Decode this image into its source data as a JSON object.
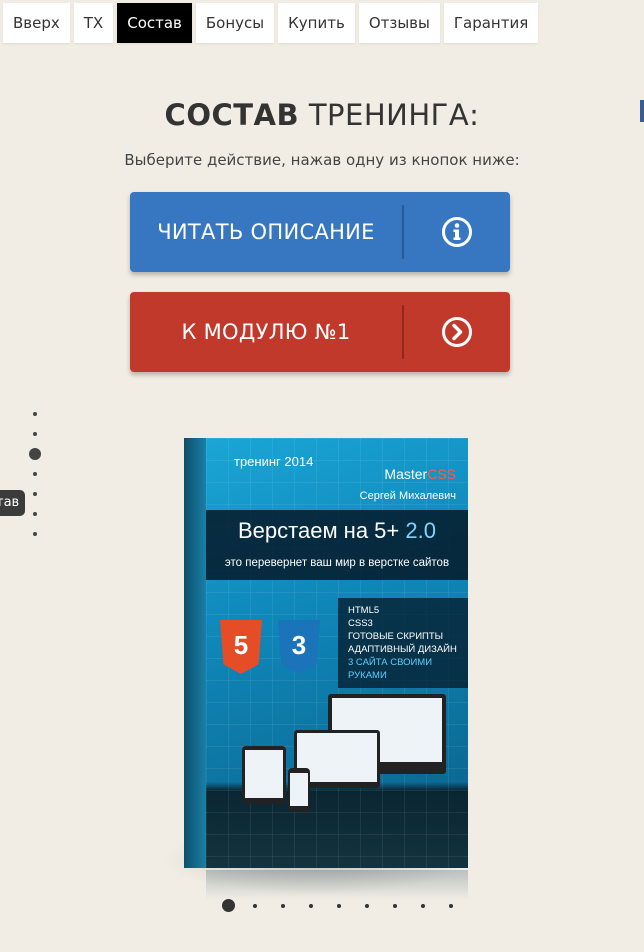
{
  "nav": {
    "items": [
      {
        "label": "Вверх",
        "active": false
      },
      {
        "label": "ТХ",
        "active": false
      },
      {
        "label": "Состав",
        "active": true
      },
      {
        "label": "Бонусы",
        "active": false
      },
      {
        "label": "Купить",
        "active": false
      },
      {
        "label": "Отзывы",
        "active": false
      },
      {
        "label": "Гарантия",
        "active": false
      }
    ]
  },
  "section": {
    "title_bold": "СОСТАВ",
    "title_light": "ТРЕНИНГА:",
    "subtitle": "Выберите действие, нажав одну из кнопок ниже:"
  },
  "buttons": {
    "read": {
      "label": "ЧИТАТЬ ОПИСАНИЕ",
      "icon": "info-icon",
      "color": "#3777c2"
    },
    "module": {
      "label": "К МОДУЛЮ №1",
      "icon": "chevron-right-circle-icon",
      "color": "#c0392b"
    }
  },
  "side_nav": {
    "tooltip": "тав",
    "dot_count": 7,
    "active_index": 2
  },
  "product": {
    "year": "тренинг 2014",
    "brand_main": "Master",
    "brand_accent": "CSS",
    "author": "Сергей Михалевич",
    "headline_main": "Верстаем на 5+",
    "headline_version": "2.0",
    "tagline": "это перевернет ваш мир в верстке сайтов",
    "features": [
      "HTML5",
      "CSS3",
      "ГОТОВЫЕ СКРИПТЫ",
      "АДАПТИВНЫЙ ДИЗАЙН"
    ],
    "features_highlight": "3 САЙТА СВОИМИ РУКАМИ",
    "shield_html": "5",
    "shield_css": "3"
  },
  "carousel": {
    "dot_count": 9,
    "active_index": 0
  }
}
